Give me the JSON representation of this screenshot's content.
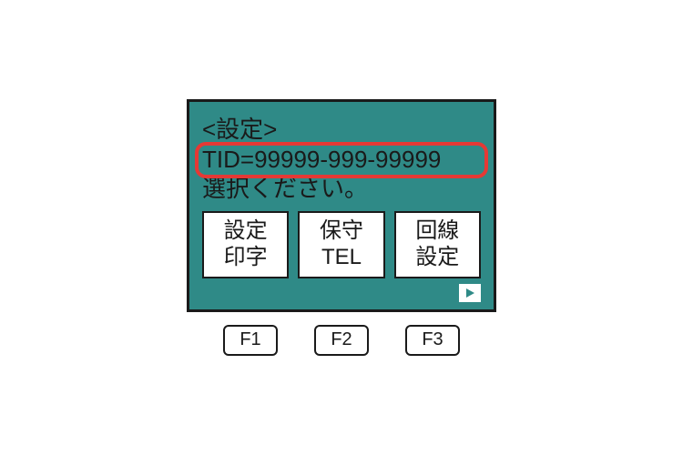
{
  "screen": {
    "title": "<設定>",
    "tid_line": "TID=99999-999-99999",
    "prompt": "選択ください。",
    "buttons": [
      {
        "line1": "設定",
        "line2": "印字"
      },
      {
        "line1": "保守",
        "line2": "TEL"
      },
      {
        "line1": "回線",
        "line2": "設定"
      }
    ]
  },
  "fkeys": [
    "F1",
    "F2",
    "F3"
  ]
}
